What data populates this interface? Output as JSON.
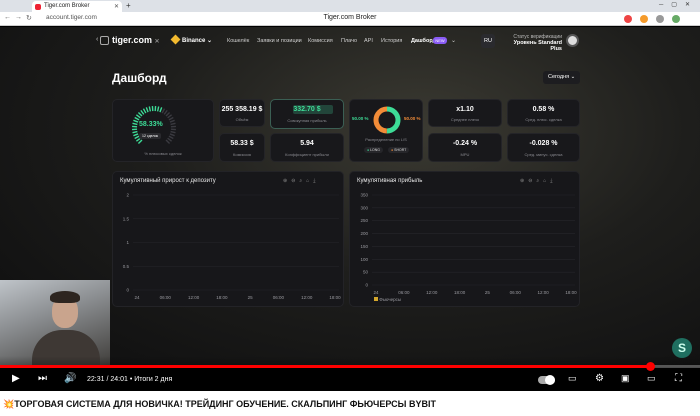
{
  "browser": {
    "tab_title": "Tiger.com Broker",
    "url": "account.tiger.com",
    "page_title": "Tiger.com Broker"
  },
  "nav": {
    "brand": "tiger.com",
    "brand_close": "✕",
    "exchange": "Binance",
    "items": [
      "Кошелёк",
      "Заявки и позиции",
      "Комиссия",
      "Плачо",
      "API",
      "История"
    ],
    "active_item": "Дашборд",
    "new_badge": "NEW",
    "lang": "RU",
    "verification_label": "Статус верификации",
    "verification_level": "Уровень Standard Plus"
  },
  "dashboard": {
    "title": "Дашборд",
    "period": "Сегодня",
    "winrate": {
      "value": "58.33%",
      "trades": "12 сделок",
      "label": "% плюсовых сделок"
    },
    "volume": {
      "value": "255 358.19 $",
      "label": "Объём"
    },
    "net_profit": {
      "value": "332.70 $",
      "label": "Совокупная прибыль"
    },
    "ls": {
      "long_pct": "50.00 %",
      "short_pct": "50.00 %",
      "label": "Распределение по L/S",
      "long": "LONG",
      "short": "SHORT"
    },
    "avg_leverage": {
      "value": "x1.10",
      "label": "Среднее плечо"
    },
    "avg_plus": {
      "value": "0.58 %",
      "label": "Сред. плюс. сделка"
    },
    "commission": {
      "value": "58.33 $",
      "label": "Комиссия"
    },
    "profit_factor": {
      "value": "5.94",
      "label": "Коэффициент прибыли"
    },
    "mpu": {
      "value": "-0.24 %",
      "label": "MPU"
    },
    "avg_minus": {
      "value": "-0.028 %",
      "label": "Сред. минус. сделка"
    }
  },
  "chart_data": [
    {
      "type": "line",
      "title": "Кумулятивный прирост к депозиту",
      "x": [
        "24",
        "06:00",
        "12:00",
        "18:00",
        "25",
        "06:00",
        "12:00",
        "18:00"
      ],
      "ylim": [
        0,
        2
      ],
      "yticks": [
        "2",
        "1.5",
        "1",
        "0.5",
        "0"
      ],
      "series": []
    },
    {
      "type": "bar",
      "title": "Кумулятивная прибыль",
      "x": [
        "24",
        "06:00",
        "12:00",
        "18:00",
        "25",
        "06:00",
        "12:00",
        "18:00"
      ],
      "ylim": [
        0,
        350
      ],
      "yticks": [
        "350",
        "300",
        "250",
        "200",
        "150",
        "100",
        "50",
        "0"
      ],
      "legend": "Фьючерсы",
      "series": []
    }
  ],
  "player": {
    "time": "22:31 / 24:01",
    "chapter": "• Итоги 2 дня",
    "progress": 0.928
  },
  "video_title": "💥ТОРГОВАЯ СИСТЕМА ДЛЯ НОВИЧКА! ТРЕЙДИНГ ОБУЧЕНИЕ. СКАЛЬПИНГ ФЬЮЧЕРСЫ BYBIT",
  "colors": {
    "accent_green": "#3ddc97",
    "progress_red": "#ff0000",
    "donut_orange": "#f28c38",
    "purple": "#8a5cf6"
  }
}
